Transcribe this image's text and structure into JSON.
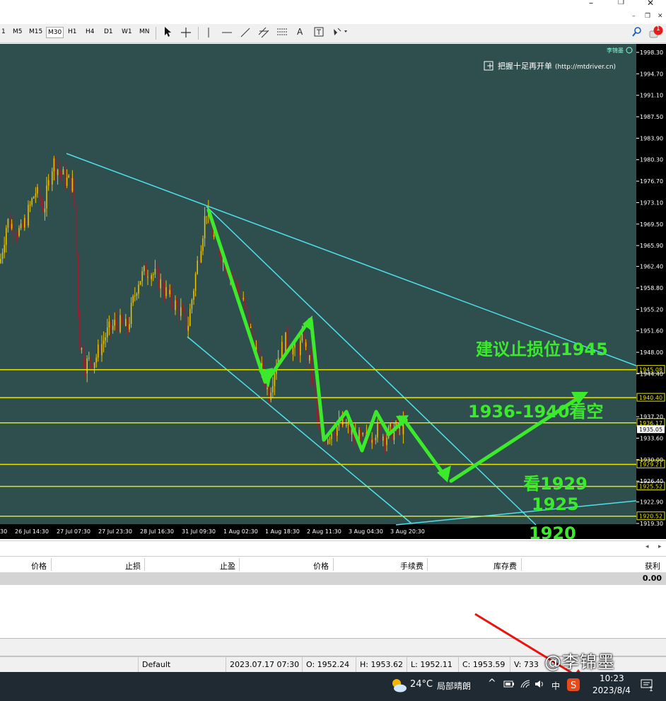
{
  "window": {
    "buttons": [
      "–",
      "❐",
      "✕"
    ]
  },
  "toolbar": {
    "timeframes": [
      "1",
      "M5",
      "M15",
      "M30",
      "H1",
      "H4",
      "D1",
      "W1",
      "MN"
    ],
    "selected": "M30",
    "tool_icons": [
      "cursor-icon",
      "crosshair-icon",
      "vertical-line-icon",
      "horizontal-line-icon",
      "trendline-icon",
      "channel-icon",
      "fibonacci-icon",
      "text-icon",
      "label-icon",
      "shapes-icon"
    ],
    "text_tool": "A",
    "notification_count": "1"
  },
  "chart": {
    "background": "#2f4f4f",
    "candle_up": "#e6c200",
    "candle_down": "#9a1f2c",
    "channel_color": "#4fe0ea",
    "level_color": "#e6e600",
    "arrow_color": "#3bea2a",
    "ylim": [
      1919.3,
      1998.3
    ],
    "y_ticks": [
      "1998.30",
      "1994.70",
      "1991.10",
      "1987.50",
      "1983.90",
      "1980.30",
      "1976.70",
      "1973.10",
      "1969.50",
      "1965.90",
      "1962.40",
      "1958.80",
      "1955.20",
      "1951.60",
      "1948.00",
      "1944.40",
      "1937.20",
      "1933.60",
      "1930.00",
      "1926.40",
      "1922.90",
      "1919.30"
    ],
    "x_ticks": [
      "30",
      "26 Jul 14:30",
      "27 Jul 07:30",
      "27 Jul 23:30",
      "28 Jul 16:30",
      "31 Jul 09:30",
      "1 Aug 02:30",
      "1 Aug 18:30",
      "2 Aug 11:30",
      "3 Aug 04:30",
      "3 Aug 20:30"
    ],
    "levels": [
      {
        "price": 1945.08,
        "label": "1945.08"
      },
      {
        "price": 1940.4,
        "label": "1940.40"
      },
      {
        "price": 1936.17,
        "label": "1936.17"
      },
      {
        "price": 1929.21,
        "label": "1929.21"
      },
      {
        "price": 1925.52,
        "label": "1925.52"
      },
      {
        "price": 1920.52,
        "label": "1920.52"
      }
    ],
    "bid_label": "1935.05",
    "indicator_title": "把握十足再开单",
    "indicator_url": "(http://mtdriver.cn)",
    "corner_label": "李锦墨",
    "annotations": {
      "stop": "建议止损位1945",
      "short": "1936-1940看空",
      "target1": "看1929",
      "target2": "1925",
      "target3": "1920"
    }
  },
  "terminal": {
    "headers": [
      "价格",
      "止损",
      "止盈",
      "价格",
      "手续费",
      "库存费",
      "获利"
    ],
    "total_profit": "0.00"
  },
  "status_bar": {
    "profile": "Default",
    "datetime": "2023.07.17 07:30",
    "open": "O: 1952.24",
    "high": "H: 1953.62",
    "low": "L: 1952.11",
    "close": "C: 1953.59",
    "volume": "V: 733"
  },
  "taskbar": {
    "temperature": "24°C",
    "weather": "局部晴朗",
    "ime": "中",
    "time": "10:23",
    "date": "2023/8/4",
    "notification_count": "1"
  },
  "watermark": "@李锦墨"
}
